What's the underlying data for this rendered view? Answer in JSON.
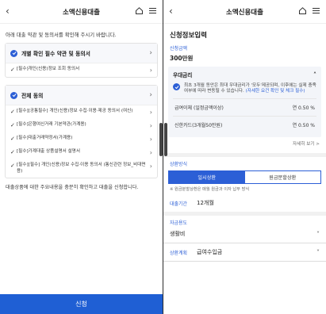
{
  "left": {
    "title": "소액신용대출",
    "intro": "아래 대출 약관 및 동의서를 확인해 주시기 바랍니다.",
    "group1": {
      "label": "개별 확인 필수 약관 및 동의서",
      "items": [
        "[필수]개인(신용)정보 조회 동의서"
      ]
    },
    "group2": {
      "label": "전체 동의",
      "items": [
        "[필수][공통필수] 개인(신용)정보 수집·이용·제공 동의서 (여신)",
        "[필수]은행여신거래 기본약관(가계용)",
        "[필수]대출거래약정서(가계용)",
        "[필수]가계대출 상품설명서 설명서",
        "[필수][필수] 개인(신용)정보 수집·이용 동의서 (통신관련 정보_비대면용)"
      ]
    },
    "notice": "대출상품에 대한 주요내용을 충분히 확인하고 대출을 신청합니다.",
    "apply_label": "신청"
  },
  "right": {
    "title": "소액신용대출",
    "section_title": "신청정보입력",
    "amount_label": "신청금액",
    "amount_value": "300만원",
    "rate": {
      "heading": "우대금리",
      "desc": "최초 3개월 동안은 최대 우대금리가 '모두'제공되며, 이후에는 실제 충족여부에 따라 변동될 수 있습니다.",
      "link": "(자세한 요건 확인 및 체크 필수)",
      "rows": [
        {
          "name": "급여이체 (일정금액이상)",
          "value": "연 0.50 %"
        },
        {
          "name": "신한카드(3개월50만원)",
          "value": "연 0.50 %"
        }
      ],
      "more": "자세히 보기 >"
    },
    "repay": {
      "label": "상환방식",
      "option_on": "일시상환",
      "option_off": "원금분할상환",
      "hint": "※ 원금분할상환은 매월 원금과 이자 납부 방식"
    },
    "period": {
      "label": "대출기간",
      "value": "12개월"
    },
    "purpose": {
      "label": "자금용도",
      "value": "생활비"
    },
    "plan": {
      "label": "상환계획",
      "value": "급여수입금"
    }
  }
}
